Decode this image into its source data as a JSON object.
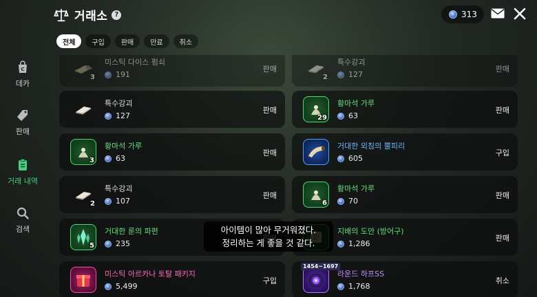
{
  "header": {
    "title": "거래소",
    "currency_amount": "313",
    "icons": {
      "title": "scale-icon",
      "help": "help-icon",
      "mail": "mail-icon",
      "close": "close-icon"
    }
  },
  "tabs": [
    {
      "label": "전체",
      "active": true
    },
    {
      "label": "구입",
      "active": false
    },
    {
      "label": "판매",
      "active": false
    },
    {
      "label": "만료",
      "active": false
    },
    {
      "label": "취소",
      "active": false
    }
  ],
  "sidebar": [
    {
      "label": "데카",
      "icon": "bag-icon",
      "active": false
    },
    {
      "label": "판매",
      "icon": "tag-icon",
      "active": false
    },
    {
      "label": "거래 내역",
      "icon": "clipboard-icon",
      "active": true
    },
    {
      "label": "검색",
      "icon": "search-icon",
      "active": false
    }
  ],
  "items": [
    {
      "name": "미스틱 다이스 펌쇠",
      "price": "191",
      "qty": "3",
      "type": "판매",
      "rarity": "plain",
      "icon": "dice-key-icon"
    },
    {
      "name": "특수강괴",
      "price": "127",
      "qty": "2",
      "type": "판매",
      "rarity": "plain",
      "icon": "ingot-icon"
    },
    {
      "name": "특수강괴",
      "price": "127",
      "qty": "",
      "type": "판매",
      "rarity": "plain",
      "icon": "ingot-icon"
    },
    {
      "name": "황마석 가루",
      "price": "63",
      "qty": "29",
      "type": "판매",
      "rarity": "green",
      "icon": "powder-icon"
    },
    {
      "name": "황마석 가루",
      "price": "63",
      "qty": "3",
      "type": "판매",
      "rarity": "green",
      "icon": "powder-icon"
    },
    {
      "name": "거대한 외침의 뿔피리",
      "price": "605",
      "qty": "",
      "type": "구입",
      "rarity": "blue",
      "icon": "horn-icon"
    },
    {
      "name": "특수강괴",
      "price": "107",
      "qty": "2",
      "type": "판매",
      "rarity": "plain",
      "icon": "ingot-icon"
    },
    {
      "name": "황마석 가루",
      "price": "70",
      "qty": "6",
      "type": "판매",
      "rarity": "green",
      "icon": "powder-icon"
    },
    {
      "name": "거대한 룬의 파편",
      "price": "235",
      "qty": "5",
      "type": "판매",
      "rarity": "green",
      "icon": "rune-shard-icon"
    },
    {
      "name": "지배의 도안 (방어구)",
      "price": "1,286",
      "qty": "",
      "type": "판매",
      "rarity": "green",
      "icon": "blueprint-icon"
    },
    {
      "name": "미스틱 아르카나 토탈 패키지",
      "price": "5,499",
      "qty": "",
      "type": "구입",
      "rarity": "pink",
      "icon": "gift-box-icon"
    },
    {
      "name": "라운드 하프SS",
      "price": "1,768",
      "qty": "",
      "type": "취소",
      "rarity": "purple",
      "icon": "harp-icon",
      "badge": "1454~1697"
    }
  ],
  "toast": {
    "line1": "아이템이 많아 무거워졌다.",
    "line2": "정리하는 게 좋을 것 같다."
  },
  "colors": {
    "active_green": "#42d17c",
    "rarity_green": "#5fe07d",
    "rarity_blue": "#6cb6ff",
    "rarity_pink": "#ff6ab5",
    "rarity_purple": "#c48cff"
  }
}
